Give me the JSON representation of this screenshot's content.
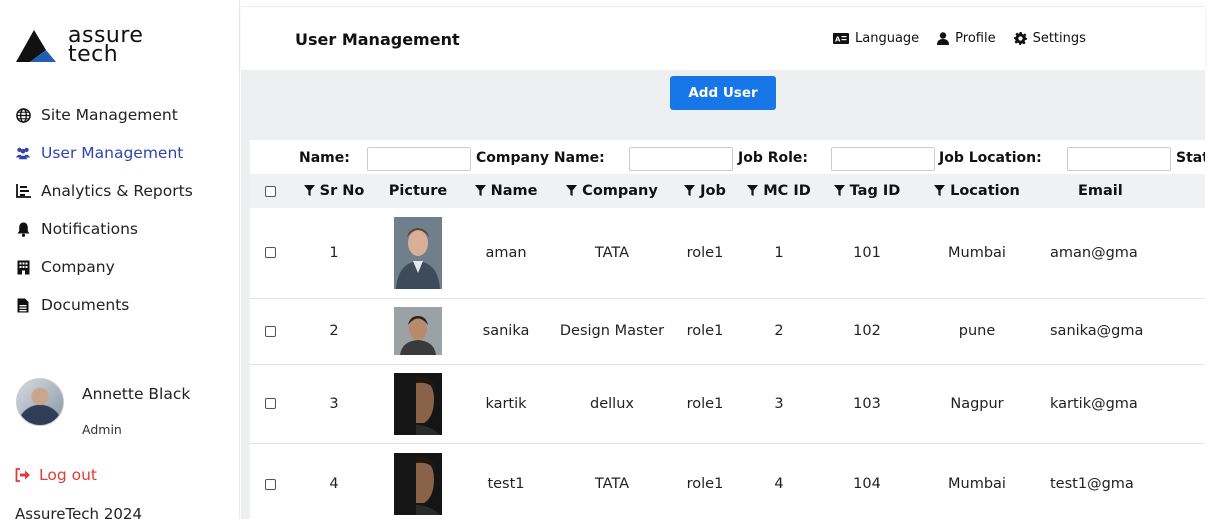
{
  "brand": {
    "line1": "assure",
    "line2": "tech",
    "accent": "#1f5fb5"
  },
  "sidebar": {
    "items": [
      {
        "label": "Site Management",
        "icon": "globe-icon",
        "active": false
      },
      {
        "label": "User Management",
        "icon": "users-icon",
        "active": true
      },
      {
        "label": "Analytics & Reports",
        "icon": "chart-icon",
        "active": false
      },
      {
        "label": "Notifications",
        "icon": "bell-icon",
        "active": false
      },
      {
        "label": "Company",
        "icon": "building-icon",
        "active": false
      },
      {
        "label": "Documents",
        "icon": "file-icon",
        "active": false
      }
    ],
    "user": {
      "name": "Annette Black",
      "role": "Admin"
    },
    "logout_label": "Log out",
    "footer": "AssureTech 2024"
  },
  "header": {
    "title": "User Management",
    "nav": [
      {
        "label": "Language",
        "icon": "language-icon"
      },
      {
        "label": "Profile",
        "icon": "profile-icon"
      },
      {
        "label": "Settings",
        "icon": "gear-icon"
      }
    ]
  },
  "toolbar": {
    "add_user_label": "Add User"
  },
  "filters": {
    "name_label": "Name:",
    "company_label": "Company Name:",
    "job_label": "Job Role:",
    "location_label": "Job Location:",
    "status_label": "Stat",
    "name_value": "",
    "company_value": "",
    "job_value": "",
    "location_value": ""
  },
  "table": {
    "columns": [
      "Sr No",
      "Picture",
      "Name",
      "Company",
      "Job",
      "MC ID",
      "Tag ID",
      "Location",
      "Email"
    ],
    "rows": [
      {
        "sr": "1",
        "name": "aman",
        "company": "TATA",
        "job": "role1",
        "mc": "1",
        "tag": "101",
        "location": "Mumbai",
        "email": "aman@gma"
      },
      {
        "sr": "2",
        "name": "sanika",
        "company": "Design Master",
        "job": "role1",
        "mc": "2",
        "tag": "102",
        "location": "pune",
        "email": "sanika@gma"
      },
      {
        "sr": "3",
        "name": "kartik",
        "company": "dellux",
        "job": "role1",
        "mc": "3",
        "tag": "103",
        "location": "Nagpur",
        "email": "kartik@gma"
      },
      {
        "sr": "4",
        "name": "test1",
        "company": "TATA",
        "job": "role1",
        "mc": "4",
        "tag": "104",
        "location": "Mumbai",
        "email": "test1@gma"
      }
    ]
  },
  "colors": {
    "primary": "#1877e8",
    "active_nav": "#2f46a8",
    "logout": "#e53935"
  }
}
